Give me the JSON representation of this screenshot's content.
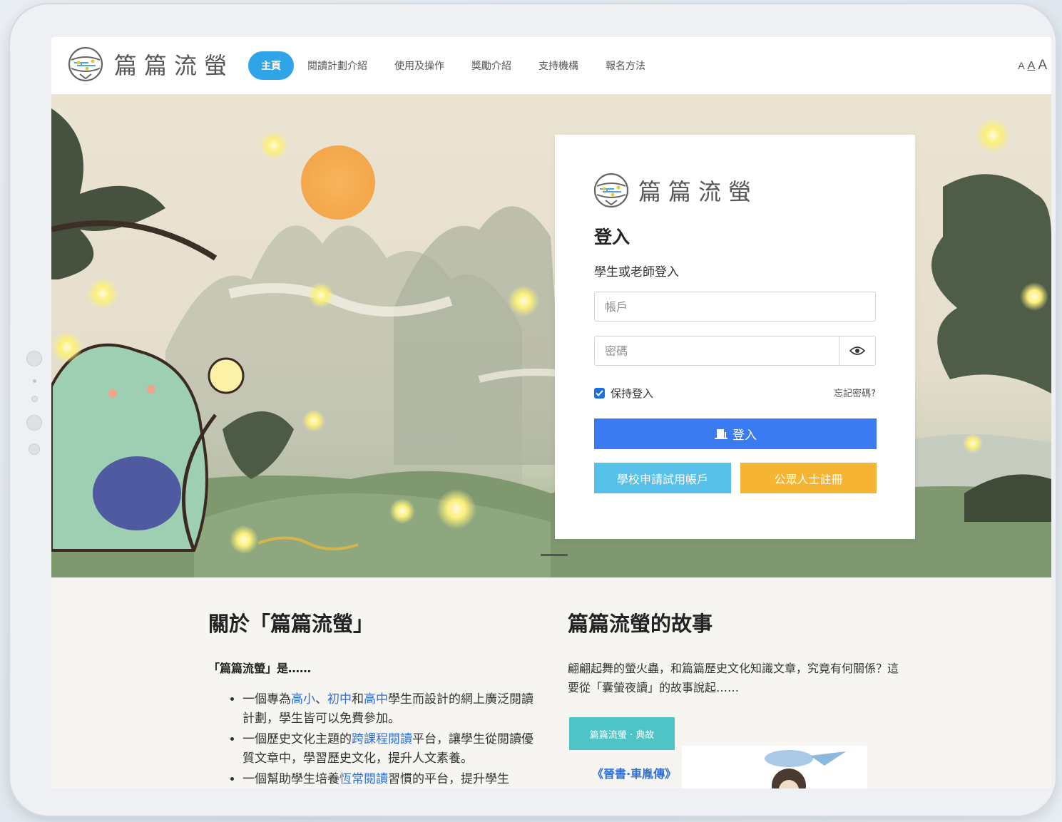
{
  "header": {
    "brand": "篇篇流螢",
    "nav": [
      {
        "label": "主頁",
        "active": true
      },
      {
        "label": "閱讀計劃介紹",
        "active": false
      },
      {
        "label": "使用及操作",
        "active": false
      },
      {
        "label": "獎勵介紹",
        "active": false
      },
      {
        "label": "支持機構",
        "active": false
      },
      {
        "label": "報名方法",
        "active": false
      }
    ],
    "font_sizes": [
      "A",
      "A",
      "A"
    ]
  },
  "login": {
    "brand": "篇篇流螢",
    "title": "登入",
    "subtitle": "學生或老師登入",
    "account_placeholder": "帳戶",
    "password_placeholder": "密碼",
    "remember_label": "保持登入",
    "remember_checked": true,
    "forgot_label": "忘記密碼?",
    "login_button": "登入",
    "school_button": "學校申請試用帳戶",
    "public_button": "公眾人士註冊"
  },
  "about": {
    "title": "關於「篇篇流螢」",
    "lead": "「篇篇流螢」是……",
    "items": [
      {
        "pre": "一個專為",
        "h1": "高小",
        "m1": "、",
        "h2": "初中",
        "m2": "和",
        "h3": "高中",
        "post": "學生而設計的網上廣泛閱讀計劃，學生皆可以免費參加。"
      },
      {
        "pre": "一個歷史文化主題的",
        "h1": "跨課程閱讀",
        "post": "平台，讓學生從閱讀優質文章中，學習歷史文化，提升人文素養。"
      },
      {
        "pre": "一個幫助學生培養",
        "h1": "恆常閱讀",
        "post": "習慣的平台，提升學生"
      }
    ]
  },
  "story": {
    "title": "篇篇流螢的故事",
    "text": "翩翩起舞的螢火蟲，和篇篇歷史文化知識文章，究竟有何關係？這要從「囊螢夜讀」的故事說起……",
    "tag": "篇篇流螢 · 典故",
    "book": "《晉書·車胤傳》"
  },
  "colors": {
    "nav_active": "#2fa4e7",
    "login_button": "#3a7bf2",
    "school_button": "#56c0e8",
    "public_button": "#f5b533",
    "highlight": "#2f6fd0",
    "tag": "#4fc4c7"
  }
}
